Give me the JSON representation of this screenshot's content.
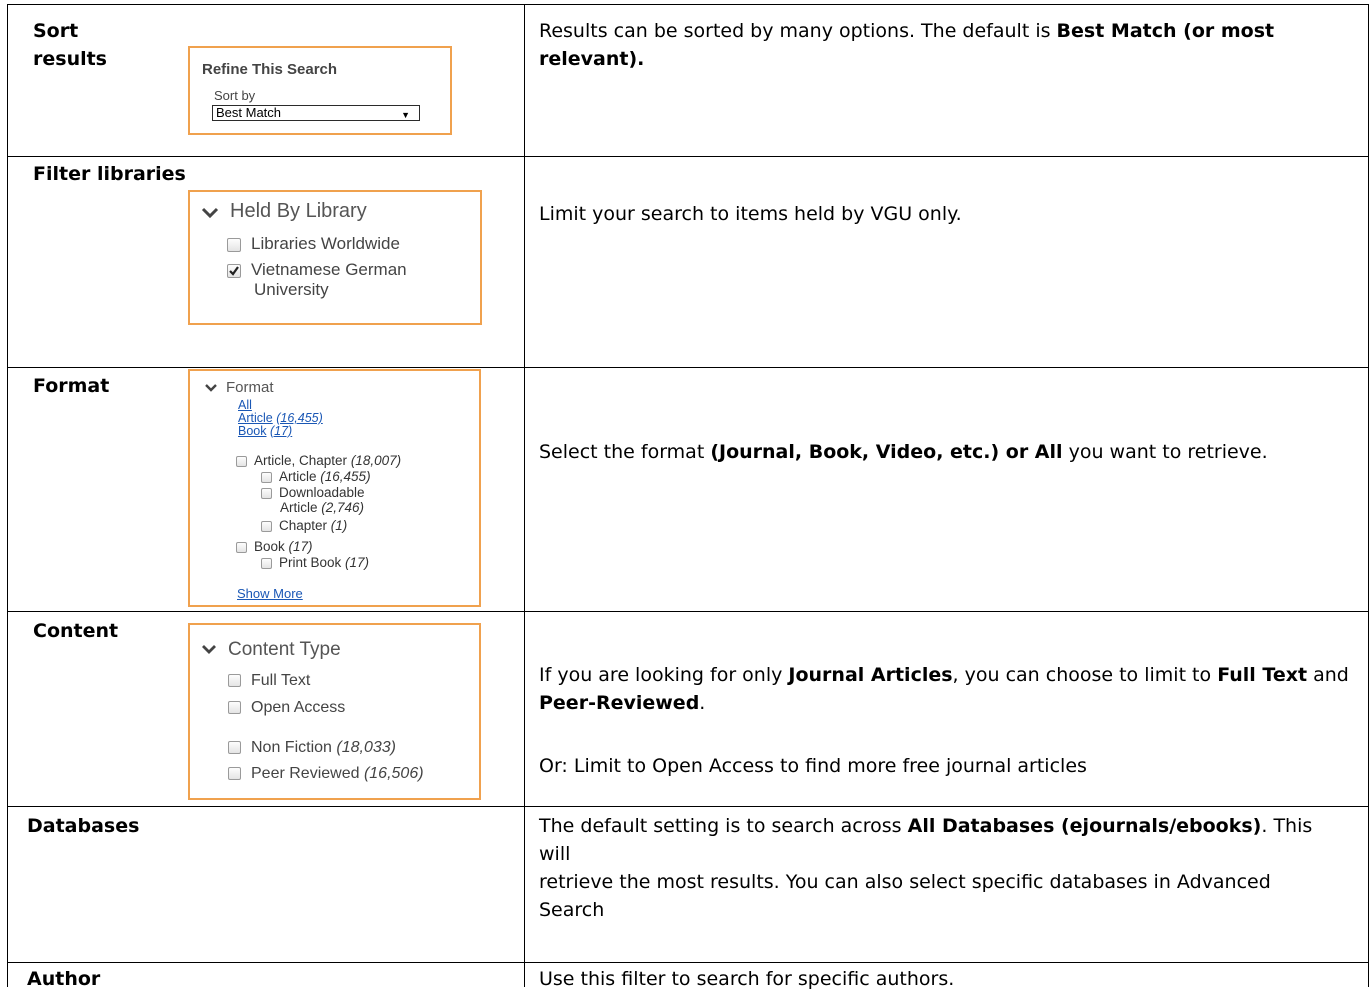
{
  "rows": {
    "sort": {
      "label_line1": "Sort",
      "label_line2": "results",
      "widget": {
        "title": "Refine This Search",
        "sort_by_label": "Sort by",
        "selected_option": "Best Match"
      },
      "desc_text": "Results can be sorted by many options. The default is ",
      "desc_bold": "Best Match (or most relevant)."
    },
    "filter": {
      "label": "Filter libraries",
      "widget": {
        "heading": "Held By Library",
        "options": [
          {
            "label": "Libraries Worldwide",
            "checked": false
          },
          {
            "label_line1": "Vietnamese German",
            "label_line2": "University",
            "checked": true
          }
        ]
      },
      "desc": "Limit your search to items held by VGU only."
    },
    "format": {
      "label": "Format",
      "widget": {
        "heading": "Format",
        "links": [
          {
            "label": "All",
            "count": ""
          },
          {
            "label": "Article",
            "count": "(16,455)"
          },
          {
            "label": "Book",
            "count": "(17)"
          }
        ],
        "options": [
          {
            "label": "Article, Chapter",
            "count": "(18,007)"
          },
          {
            "label": "Article",
            "count": "(16,455)"
          },
          {
            "label_line1": "Downloadable",
            "label_line2": "Article",
            "count": "(2,746)"
          },
          {
            "label": "Chapter",
            "count": "(1)"
          },
          {
            "label": "Book",
            "count": "(17)"
          },
          {
            "label": "Print Book",
            "count": "(17)"
          }
        ],
        "show_more": "Show More"
      },
      "desc_pre": "Select the format ",
      "desc_bold1": "(Journal, Book, Video, etc.) or All",
      "desc_post": " you want to retrieve."
    },
    "content": {
      "label": "Content",
      "widget": {
        "heading": "Content Type",
        "options": [
          {
            "label": "Full Text",
            "count": ""
          },
          {
            "label": "Open Access",
            "count": ""
          },
          {
            "label": "Non Fiction",
            "count": "(18,033)"
          },
          {
            "label": "Peer Reviewed",
            "count": "(16,506)"
          }
        ]
      },
      "desc_p1_a": "If you are looking for only ",
      "desc_p1_b": "Journal Articles",
      "desc_p1_c": ", you can choose to limit to ",
      "desc_p1_d": "Full Text",
      "desc_p1_e": " and ",
      "desc_p1_f": "Peer-Reviewed",
      "desc_p1_g": ".",
      "desc_p2": "Or: Limit to Open Access to find more free journal articles"
    },
    "databases": {
      "label": "Databases",
      "desc_a": "The default setting is to search across ",
      "desc_b": "All Databases (ejournals/ebooks)",
      "desc_c": ". This will",
      "desc_d": "retrieve the most results. You can also select specific databases in Advanced Search"
    },
    "author": {
      "label": "Author",
      "desc": "Use this filter to search for specific authors."
    }
  },
  "colors": {
    "widget_border": "#f0a14e",
    "link": "#1a57b5",
    "rule": "#000000"
  }
}
